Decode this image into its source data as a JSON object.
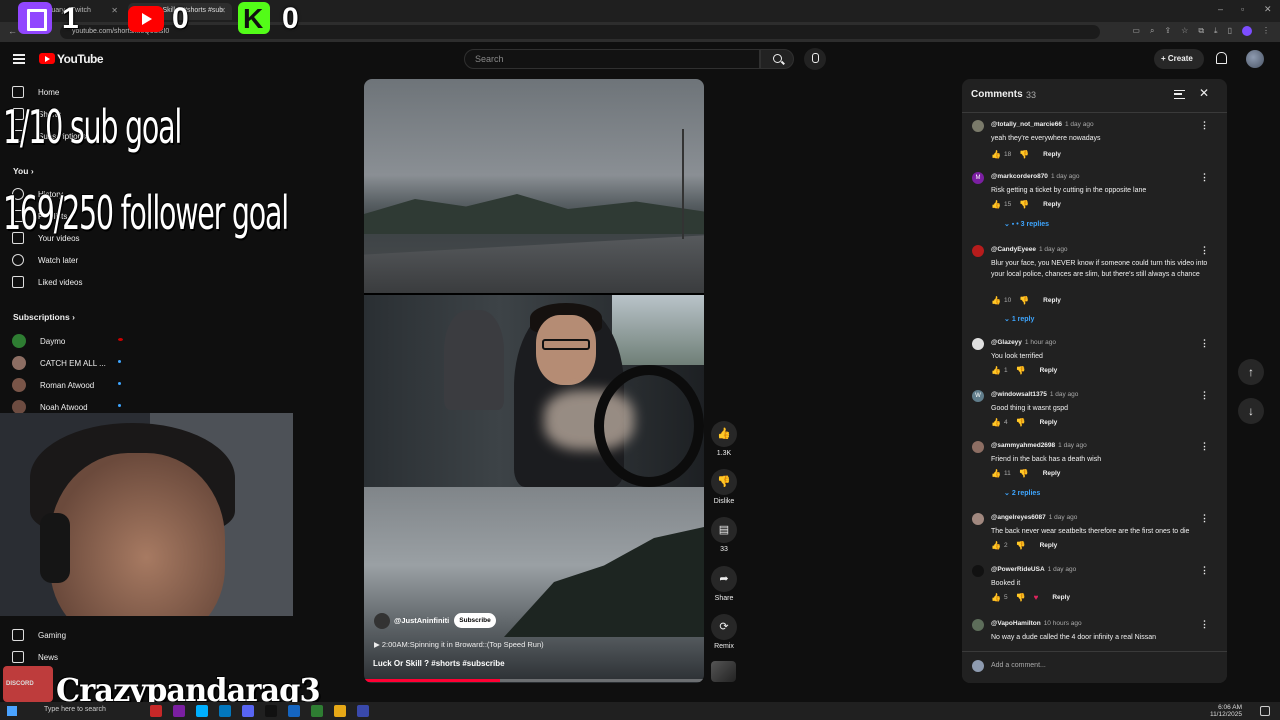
{
  "browser": {
    "tabs": [
      {
        "label": "vapor_tuary - Twitch"
      },
      {
        "label": "Luck Or Skill ? #shorts #sub"
      }
    ],
    "url": "youtube.com/shorts/kfeQcUlsI0"
  },
  "overlay": {
    "twitch_count": "1",
    "youtube_count": "0",
    "kick_count": "0",
    "sub_goal": "1/10 sub goal",
    "follower_goal": "169/250 follower goal",
    "streamer_name": "Crazypandarag3",
    "discord_label": "DISCORD"
  },
  "header": {
    "logo_text": "YouTube",
    "search_placeholder": "Search",
    "create_label": "Create"
  },
  "sidebar": {
    "top_items": [
      {
        "label": "Home",
        "icon": "home-icon"
      },
      {
        "label": "Shorts",
        "icon": "shorts-icon"
      },
      {
        "label": "Subscriptions",
        "icon": "subscriptions-icon"
      }
    ],
    "you_label": "You",
    "you_items": [
      {
        "label": "History",
        "icon": "history-icon"
      },
      {
        "label": "Playlists",
        "icon": "playlist-icon"
      },
      {
        "label": "Your videos",
        "icon": "video-icon"
      },
      {
        "label": "Watch later",
        "icon": "clock-icon"
      },
      {
        "label": "Liked videos",
        "icon": "thumbs-up-icon"
      }
    ],
    "subscriptions_label": "Subscriptions",
    "subscriptions": [
      {
        "name": "Daymo",
        "color": "#2e7d32",
        "indicator": "live"
      },
      {
        "name": "CATCH EM ALL ...",
        "color": "#8d6e63",
        "indicator": "new"
      },
      {
        "name": "Roman Atwood",
        "color": "#795548",
        "indicator": "new"
      },
      {
        "name": "Noah Atwood",
        "color": "#6d4c41",
        "indicator": "new"
      }
    ],
    "explore_items": [
      {
        "label": "Gaming",
        "icon": "gaming-icon"
      },
      {
        "label": "News",
        "icon": "news-icon"
      }
    ]
  },
  "video": {
    "channel": "@JustAninfiniti",
    "subscribe_label": "Subscribe",
    "music": "2:00AM:Spinning it in Broward::(Top Speed Run)",
    "title": "Luck Or Skill ? #shorts #subscribe",
    "progress_percent": 40
  },
  "actions": {
    "likes": "1.3K",
    "dislike_label": "Dislike",
    "comments_count": "33",
    "share_label": "Share",
    "remix_label": "Remix"
  },
  "comments_panel": {
    "title": "Comments",
    "count": "33",
    "add_placeholder": "Add a comment...",
    "reply_label": "Reply",
    "comments": [
      {
        "user": "@totally_not_marcie66",
        "time": "1 day ago",
        "text": "yeah they're everywhere nowadays",
        "likes": "18",
        "avatar_color": "#7a7a6a",
        "avatar_letter": ""
      },
      {
        "user": "@markcordero870",
        "time": "1 day ago",
        "text": "Risk getting a ticket by cutting in the opposite lane",
        "likes": "15",
        "avatar_color": "#7b1fa2",
        "avatar_letter": "M",
        "replies": "3 replies"
      },
      {
        "user": "@CandyEyeee",
        "time": "1 day ago",
        "text": "Blur your face, you NEVER know if someone could turn this video into your local police, chances are slim, but there's still always a chance",
        "likes": "10",
        "avatar_color": "#b71c1c",
        "avatar_letter": "",
        "replies": "1 reply"
      },
      {
        "user": "@Glazeyy",
        "time": "1 hour ago",
        "text": "You look terrified",
        "likes": "1",
        "avatar_color": "#e0e0e0",
        "avatar_letter": ""
      },
      {
        "user": "@windowsalt1375",
        "time": "1 day ago",
        "text": "Good thing it wasnt gspd",
        "likes": "4",
        "avatar_color": "#607d8b",
        "avatar_letter": "W"
      },
      {
        "user": "@sammyahmed2698",
        "time": "1 day ago",
        "text": "Friend in the back has a death wish",
        "likes": "11",
        "avatar_color": "#8d6e63",
        "avatar_letter": "",
        "replies": "2 replies"
      },
      {
        "user": "@angelreyes6087",
        "time": "1 day ago",
        "text": "The back never wear seatbelts therefore are the first ones to die",
        "likes": "2",
        "avatar_color": "#a1887f",
        "avatar_letter": ""
      },
      {
        "user": "@PowerRideUSA",
        "time": "1 day ago",
        "text": "Booked it",
        "likes": "5",
        "avatar_color": "#111111",
        "avatar_letter": "",
        "hearted": true
      },
      {
        "user": "@VapoHamilton",
        "time": "10 hours ago",
        "text": "No way a dude called the 4 door infinity a real Nissan",
        "likes": "",
        "avatar_color": "#5d6d5a",
        "avatar_letter": ""
      }
    ]
  },
  "taskbar": {
    "search_placeholder": "Type here to search",
    "time": "6:06 AM",
    "date": "11/12/2025",
    "apps": [
      "#c62828",
      "#7b1fa2",
      "#00b0ff",
      "#0277bd",
      "#5865f2",
      "#111111",
      "#1565c0",
      "#2e7d32",
      "#e6a817",
      "#3949ab"
    ]
  }
}
